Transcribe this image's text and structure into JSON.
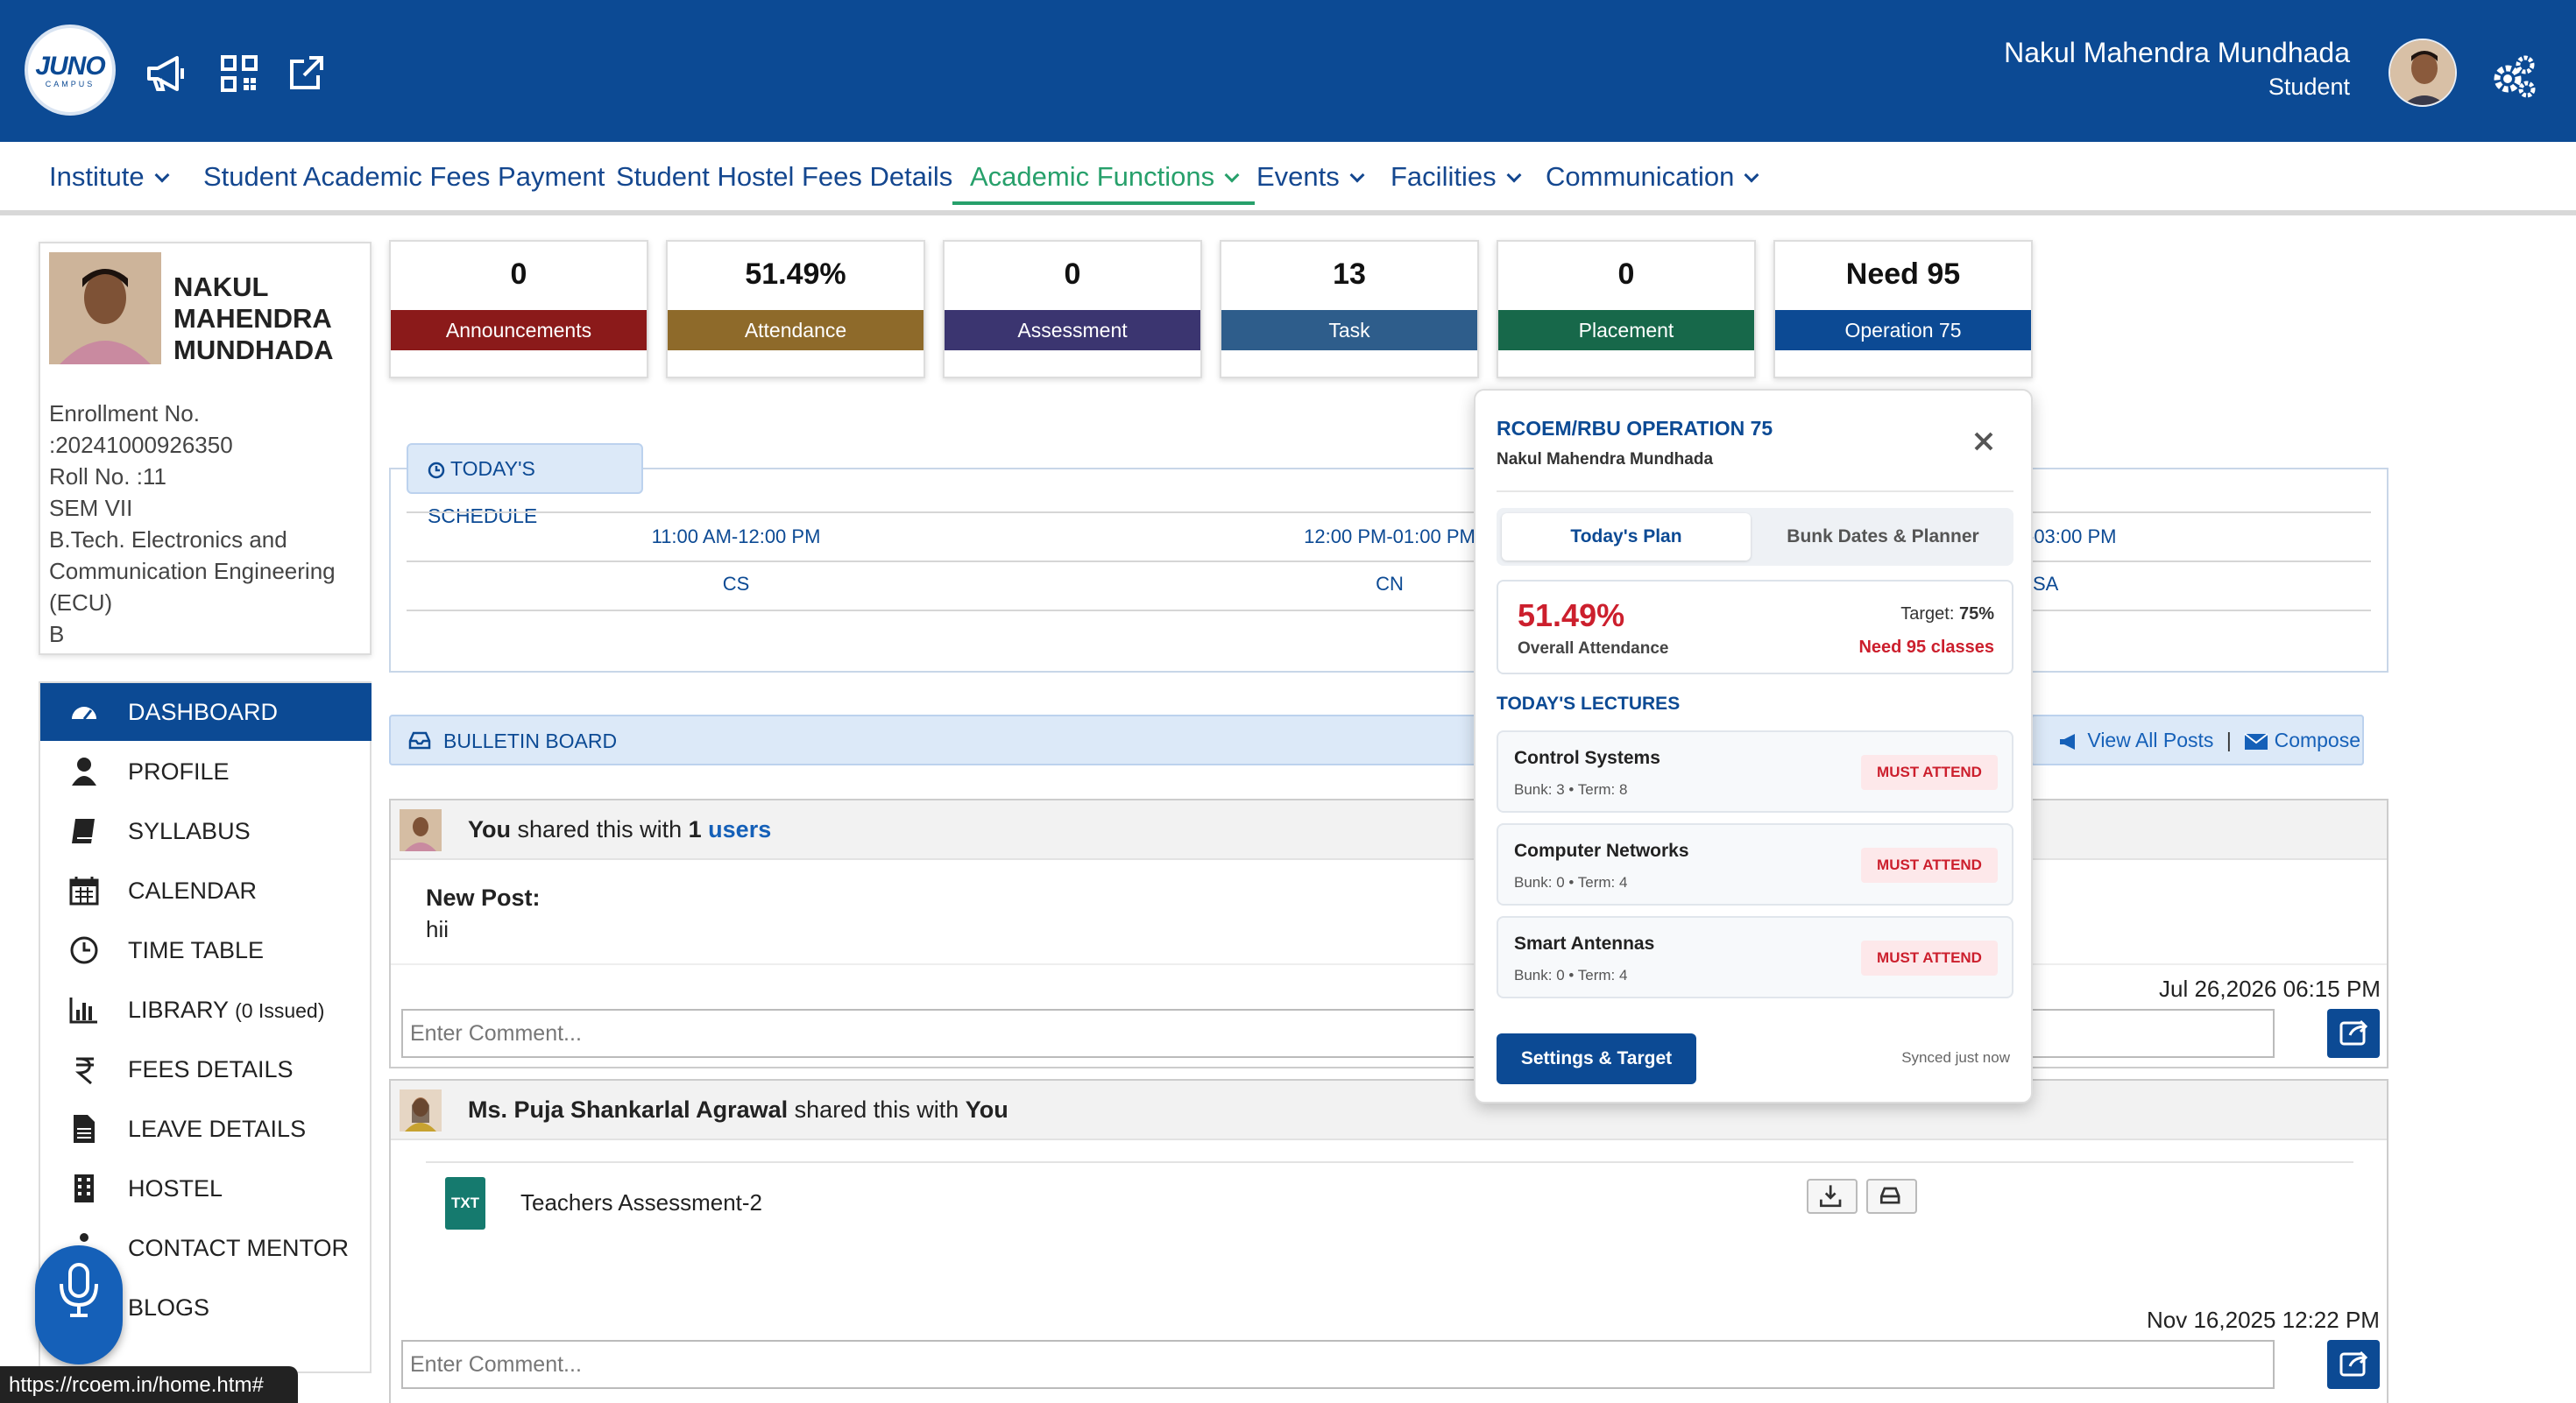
{
  "header": {
    "logo_text": "JUNO",
    "logo_sub": "CAMPUS",
    "user_name": "Nakul Mahendra Mundhada",
    "user_role": "Student"
  },
  "menu": {
    "items": [
      {
        "label": "Institute",
        "dropdown": true
      },
      {
        "label": "Student Academic Fees Payment",
        "dropdown": false
      },
      {
        "label": "Student Hostel Fees Details",
        "dropdown": false
      },
      {
        "label": "Academic Functions",
        "dropdown": true,
        "active": true
      },
      {
        "label": "Events",
        "dropdown": true
      },
      {
        "label": "Facilities",
        "dropdown": true
      },
      {
        "label": "Communication",
        "dropdown": true
      }
    ]
  },
  "profile": {
    "name": "NAKUL MAHENDRA MUNDHADA",
    "lines": [
      "Enrollment No.",
      ":20241000926350",
      "Roll No. :11",
      "SEM VII",
      "B.Tech. Electronics and",
      "Communication Engineering",
      "(ECU)",
      "B"
    ]
  },
  "sidebar": {
    "items": [
      {
        "label": "DASHBOARD",
        "icon": "dashboard-icon",
        "active": true
      },
      {
        "label": "PROFILE",
        "icon": "user-icon"
      },
      {
        "label": "SYLLABUS",
        "icon": "book-icon"
      },
      {
        "label": "CALENDAR",
        "icon": "calendar-icon"
      },
      {
        "label": "TIME TABLE",
        "icon": "clock-icon"
      },
      {
        "label": "LIBRARY",
        "suffix": "(0 Issued)",
        "icon": "bar-chart-icon"
      },
      {
        "label": "FEES DETAILS",
        "icon": "rupee-icon"
      },
      {
        "label": "LEAVE DETAILS",
        "icon": "document-icon"
      },
      {
        "label": "HOSTEL",
        "icon": "building-icon"
      },
      {
        "label": "CONTACT MENTOR",
        "icon": "mentor-icon"
      },
      {
        "label": "BLOGS",
        "icon": "blog-icon"
      }
    ]
  },
  "cards": [
    {
      "value": "0",
      "label": "Announcements",
      "color": "#8b1a1a"
    },
    {
      "value": "51.49%",
      "label": "Attendance",
      "color": "#8e6a2a"
    },
    {
      "value": "0",
      "label": "Assessment",
      "color": "#3b3570"
    },
    {
      "value": "13",
      "label": "Task",
      "color": "#2e5d8b"
    },
    {
      "value": "0",
      "label": "Placement",
      "color": "#17684a"
    },
    {
      "value": "Need 95",
      "label": "Operation 75",
      "color": "#0c4a94"
    }
  ],
  "schedule": {
    "tag": "TODAY'S SCHEDULE",
    "slots": [
      {
        "time": "11:00 AM-12:00 PM",
        "subject": "CS"
      },
      {
        "time": "12:00 PM-01:00 PM",
        "subject": "CN"
      },
      {
        "time": "-03:00 PM",
        "subject": "SA"
      }
    ]
  },
  "bulletin": {
    "title": "BULLETIN BOARD",
    "view_all": "View All Posts",
    "separator": "|",
    "compose": "Compose"
  },
  "posts": [
    {
      "author": "You",
      "shared_text": "shared this with",
      "count": "1",
      "target": "users",
      "body_title": "New Post:",
      "body": "hii",
      "date": "Jul 26,2026 06:15 PM",
      "comment_placeholder": "Enter Comment..."
    },
    {
      "author": "Ms. Puja Shankarlal Agrawal",
      "shared_text": "shared this with",
      "target": "You",
      "file_type": "TXT",
      "file_name": "Teachers Assessment-2",
      "date": "Nov 16,2025 12:22 PM",
      "comment_placeholder": "Enter Comment..."
    }
  ],
  "popup": {
    "title": "RCOEM/RBU OPERATION 75",
    "subtitle": "Nakul Mahendra Mundhada",
    "tab_active": "Today's Plan",
    "tab_other": "Bunk Dates & Planner",
    "attendance_pct": "51.49%",
    "attendance_label": "Overall Attendance",
    "target_label": "Target:",
    "target_value": "75%",
    "need_text": "Need 95 classes",
    "lectures_heading": "TODAY'S LECTURES",
    "lectures": [
      {
        "name": "Control Systems",
        "meta": "Bunk: 3 • Term: 8",
        "badge": "MUST ATTEND"
      },
      {
        "name": "Computer Networks",
        "meta": "Bunk: 0 • Term: 4",
        "badge": "MUST ATTEND"
      },
      {
        "name": "Smart Antennas",
        "meta": "Bunk: 0 • Term: 4",
        "badge": "MUST ATTEND"
      }
    ],
    "button": "Settings & Target",
    "sync": "Synced just now"
  },
  "statusbar": {
    "url": "https://rcoem.in/home.htm#"
  }
}
